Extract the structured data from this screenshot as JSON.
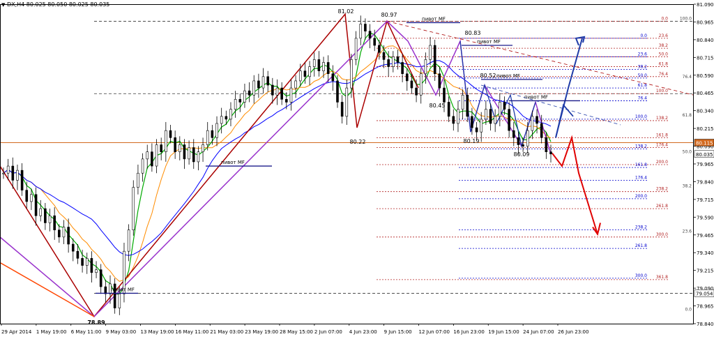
{
  "chart_data": {
    "type": "line",
    "title": "DX,H4 80.025 80.050 80.025 80.035",
    "symbol": "DX,H4",
    "ohlc": {
      "open": "80.025",
      "high": "80.050",
      "low": "80.025",
      "close": "80.035"
    },
    "colors": {
      "candle": "#000000",
      "bull_segment": "#00aa00",
      "ma_fast": "#ff8c00",
      "ma_slow": "#0000ff",
      "zigzag_red": "#aa0000",
      "zigzag_purple": "#9932cc",
      "forecast_up": "#1f3ca8",
      "forecast_down": "#e00000",
      "fib_red": "#b22222",
      "fib_blue": "#0000cd",
      "grid": "#000000"
    },
    "price_axis": {
      "ticks": [
        "81.090",
        "80.965",
        "80.840",
        "80.715",
        "80.590",
        "80.465",
        "80.340",
        "80.215",
        "80.090",
        "79.965",
        "79.840",
        "79.715",
        "79.590",
        "79.465",
        "79.340",
        "79.215",
        "79.090",
        "78.965",
        "78.840"
      ],
      "current_price": "80.115",
      "last_price": "80.035",
      "marker_price": "79.054"
    },
    "time_axis": [
      "29 Apr 2014",
      "1 May 19:00",
      "6 May 11:00",
      "9 May 03:00",
      "13 May 19:00",
      "16 May 11:00",
      "21 May 03:00",
      "23 May 19:00",
      "28 May 15:00",
      "2 Jun 07:00",
      "4 Jun 23:00",
      "9 Jun 15:00",
      "12 Jun 07:00",
      "16 Jun 23:00",
      "19 Jun 15:00",
      "24 Jun 07:00",
      "26 Jun 23:00"
    ],
    "extremes": [
      {
        "label": "78.89",
        "x": "6 May 11:00",
        "y": 78.89
      },
      {
        "label": "81.02",
        "x": "4 Jun 23:00",
        "y": 81.02
      },
      {
        "label": "80.22",
        "x": "5 Jun",
        "y": 80.22
      },
      {
        "label": "80.97",
        "x": "9 Jun 15:00",
        "y": 80.97
      },
      {
        "label": "80.83",
        "x": "16 Jun",
        "y": 80.83
      },
      {
        "label": "80.45",
        "x": "13 Jun",
        "y": 80.45
      },
      {
        "label": "80.52",
        "x": "18 Jun",
        "y": 80.52
      },
      {
        "label": "80.19",
        "x": "19 Jun",
        "y": 80.19
      },
      {
        "label": "80.09",
        "x": "25 Jun",
        "y": 80.09
      }
    ],
    "pivot_label": "пивот MF",
    "pivots": [
      {
        "label": "пивот MF",
        "y": 79.054
      },
      {
        "label": "пивот MF",
        "y": 79.95
      },
      {
        "label": "пивот MF",
        "y": 80.96
      },
      {
        "label": "пивот MF",
        "y": 80.8
      },
      {
        "label": "пивот MF",
        "y": 80.56
      },
      {
        "label": "пивот MF",
        "y": 80.41
      }
    ],
    "fib_red_levels": [
      {
        "label": "0.0",
        "y": 80.97
      },
      {
        "label": "23.6",
        "y": 80.85
      },
      {
        "label": "38.2",
        "y": 80.78
      },
      {
        "label": "50.0",
        "y": 80.72
      },
      {
        "label": "61.8",
        "y": 80.65
      },
      {
        "label": "76.4",
        "y": 80.58
      },
      {
        "label": "100.0",
        "y": 80.46
      },
      {
        "label": "138.2",
        "y": 80.27
      },
      {
        "label": "161.8",
        "y": 80.15
      },
      {
        "label": "176.4",
        "y": 80.08
      },
      {
        "label": "200.0",
        "y": 79.96
      },
      {
        "label": "238.2",
        "y": 79.77
      },
      {
        "label": "261.8",
        "y": 79.65
      },
      {
        "label": "300.0",
        "y": 79.45
      },
      {
        "label": "361.8",
        "y": 79.15
      }
    ],
    "fib_blue_levels": [
      {
        "label": "0.0",
        "y": 80.85
      },
      {
        "label": "23.6",
        "y": 80.72
      },
      {
        "label": "38.2",
        "y": 80.63
      },
      {
        "label": "50.0",
        "y": 80.57
      },
      {
        "label": "61.8",
        "y": 80.5
      },
      {
        "label": "76.4",
        "y": 80.41
      },
      {
        "label": "100.0",
        "y": 80.28
      },
      {
        "label": "138.2",
        "y": 80.07
      },
      {
        "label": "161.8",
        "y": 79.94
      },
      {
        "label": "176.4",
        "y": 79.85
      },
      {
        "label": "200.0",
        "y": 79.72
      },
      {
        "label": "238.2",
        "y": 79.5
      },
      {
        "label": "261.8",
        "y": 79.37
      },
      {
        "label": "300.0",
        "y": 79.16
      }
    ],
    "fib_right_labels": [
      {
        "label": "100.0",
        "y": 80.98
      },
      {
        "label": "76.4",
        "y": 80.57
      },
      {
        "label": "61.8",
        "y": 80.3
      },
      {
        "label": "50.0",
        "y": 80.04
      },
      {
        "label": "38.2",
        "y": 79.8
      },
      {
        "label": "23.6",
        "y": 79.48
      },
      {
        "label": "0.0",
        "y": 78.93
      }
    ],
    "close": [
      79.9,
      79.95,
      79.85,
      79.92,
      79.78,
      79.7,
      79.75,
      79.6,
      79.65,
      79.55,
      79.6,
      79.5,
      79.45,
      79.52,
      79.4,
      79.35,
      79.3,
      79.25,
      79.3,
      79.2,
      79.22,
      79.1,
      79.05,
      79.12,
      78.95,
      79.05,
      79.35,
      79.5,
      79.8,
      79.9,
      80.0,
      80.05,
      79.95,
      80.1,
      80.05,
      80.2,
      80.15,
      80.05,
      80.1,
      80.0,
      80.08,
      79.98,
      80.05,
      80.1,
      80.2,
      80.15,
      80.25,
      80.3,
      80.28,
      80.35,
      80.42,
      80.4,
      80.48,
      80.45,
      80.55,
      80.5,
      80.58,
      80.52,
      80.45,
      80.5,
      80.42,
      80.4,
      80.5,
      80.55,
      80.62,
      80.58,
      80.65,
      80.7,
      80.62,
      80.68,
      80.6,
      80.55,
      80.4,
      80.3,
      80.5,
      80.7,
      80.85,
      80.95,
      80.9,
      80.85,
      80.8,
      80.75,
      80.7,
      80.65,
      80.72,
      80.68,
      80.6,
      80.55,
      80.5,
      80.45,
      80.6,
      80.7,
      80.8,
      80.6,
      80.5,
      80.4,
      80.3,
      80.25,
      80.35,
      80.45,
      80.3,
      80.22,
      80.19,
      80.28,
      80.35,
      80.25,
      80.3,
      80.4,
      80.35,
      80.2,
      80.15,
      80.1,
      80.09,
      80.2,
      80.3,
      80.25,
      80.15,
      80.05,
      80.035
    ]
  }
}
